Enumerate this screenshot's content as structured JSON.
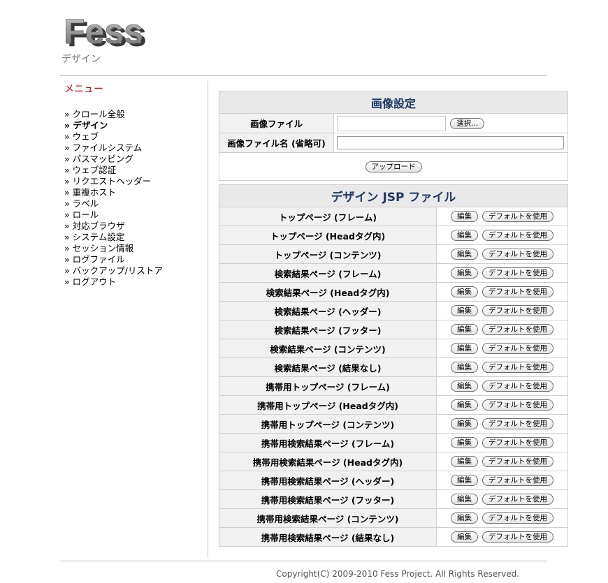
{
  "logo": {
    "text": "Fess"
  },
  "header": {
    "subtitle": "デザイン"
  },
  "sidebar": {
    "title": "メニュー",
    "items": [
      {
        "label": "» クロール全般",
        "active": false
      },
      {
        "label": "» デザイン",
        "active": true
      },
      {
        "label": "» ウェブ",
        "active": false
      },
      {
        "label": "» ファイルシステム",
        "active": false
      },
      {
        "label": "» パスマッピング",
        "active": false
      },
      {
        "label": "» ウェブ認証",
        "active": false
      },
      {
        "label": "» リクエストヘッダー",
        "active": false
      },
      {
        "label": "» 重複ホスト",
        "active": false
      },
      {
        "label": "» ラベル",
        "active": false
      },
      {
        "label": "» ロール",
        "active": false
      },
      {
        "label": "» 対応ブラウザ",
        "active": false
      },
      {
        "label": "» システム設定",
        "active": false
      },
      {
        "label": "» セッション情報",
        "active": false
      },
      {
        "label": "» ログファイル",
        "active": false
      },
      {
        "label": "» バックアップ/リストア",
        "active": false
      },
      {
        "label": "» ログアウト",
        "active": false
      }
    ]
  },
  "upload": {
    "title": "画像設定",
    "image_file_label": "画像ファイル",
    "select_button": "選択...",
    "image_name_label": "画像ファイル名 (省略可)",
    "image_name_value": "",
    "upload_button": "アップロード"
  },
  "jsp": {
    "title": "デザイン JSP ファイル",
    "edit_label": "編集",
    "default_label": "デフォルトを使用",
    "files": [
      "トップページ (フレーム)",
      "トップページ (Headタグ内)",
      "トップページ (コンテンツ)",
      "検索結果ページ (フレーム)",
      "検索結果ページ (Headタグ内)",
      "検索結果ページ (ヘッダー)",
      "検索結果ページ (フッター)",
      "検索結果ページ (コンテンツ)",
      "検索結果ページ (結果なし)",
      "携帯用トップページ (フレーム)",
      "携帯用トップページ (Headタグ内)",
      "携帯用トップページ (コンテンツ)",
      "携帯用検索結果ページ (フレーム)",
      "携帯用検索結果ページ (Headタグ内)",
      "携帯用検索結果ページ (ヘッダー)",
      "携帯用検索結果ページ (フッター)",
      "携帯用検索結果ページ (コンテンツ)",
      "携帯用検索結果ページ (結果なし)"
    ]
  },
  "footer": {
    "copyright": "Copyright(C) 2009-2010 Fess Project. All Rights Reserved."
  },
  "colors": {
    "menu_title": "#cc0000",
    "panel_title": "#1f3a66",
    "panel_header_bg": "#e9e9e9"
  }
}
